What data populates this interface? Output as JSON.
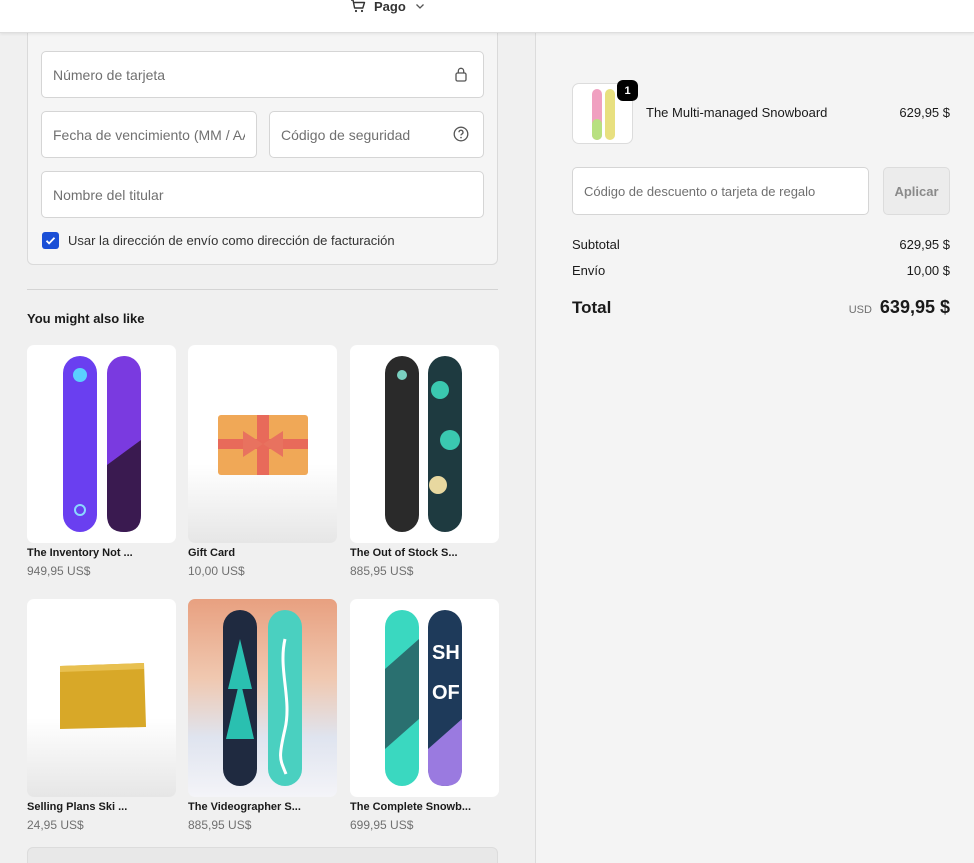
{
  "header": {
    "cart_label": "Pago"
  },
  "payment": {
    "card_number_placeholder": "Número de tarjeta",
    "expiry_placeholder": "Fecha de vencimiento (MM / AA)",
    "security_code_placeholder": "Código de seguridad",
    "holder_name_placeholder": "Nombre del titular",
    "billing_checkbox_label": "Usar la dirección de envío como dirección de facturación",
    "billing_checkbox_checked": true
  },
  "recommendations": {
    "title": "You might also like",
    "products": [
      {
        "name": "The Inventory Not ...",
        "price": "949,95 US$"
      },
      {
        "name": "Gift Card",
        "price": "10,00 US$"
      },
      {
        "name": "The Out of Stock S...",
        "price": "885,95 US$"
      },
      {
        "name": "Selling Plans Ski ...",
        "price": "24,95 US$"
      },
      {
        "name": "The Videographer S...",
        "price": "885,95 US$"
      },
      {
        "name": "The Complete Snowb...",
        "price": "699,95 US$"
      }
    ]
  },
  "order": {
    "line_item": {
      "name": "The Multi-managed Snowboard",
      "price": "629,95 $",
      "quantity": "1"
    },
    "discount_placeholder": "Código de descuento o tarjeta de regalo",
    "apply_label": "Aplicar",
    "subtotal_label": "Subtotal",
    "subtotal_value": "629,95 $",
    "shipping_label": "Envío",
    "shipping_value": "10,00 $",
    "total_label": "Total",
    "total_currency": "USD",
    "total_value": "639,95 $"
  },
  "colors": {
    "accent": "#1a4fd6",
    "badge": "#000000",
    "muted_text": "#707070"
  }
}
